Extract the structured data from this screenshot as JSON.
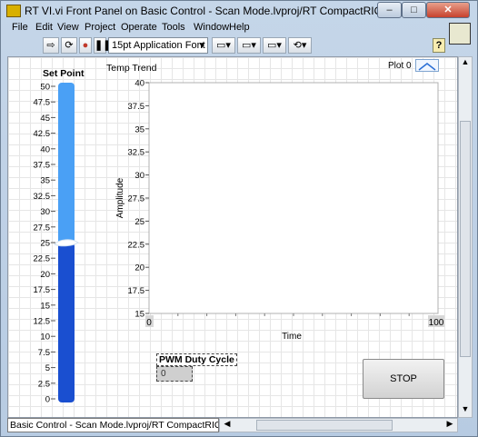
{
  "window": {
    "title": "RT VI.vi Front Panel on Basic Control - Scan Mode.lvproj/RT CompactRIO Target",
    "minimize": "–",
    "maximize": "□",
    "close": "✕"
  },
  "menu": [
    "File",
    "Edit",
    "View",
    "Project",
    "Operate",
    "Tools",
    "Window",
    "Help"
  ],
  "toolbar": {
    "font": "15pt Application Font"
  },
  "set_point": {
    "label": "Set Point",
    "ticks": [
      "50",
      "47.5",
      "45",
      "42.5",
      "40",
      "37.5",
      "35",
      "32.5",
      "30",
      "27.5",
      "25",
      "22.5",
      "20",
      "17.5",
      "15",
      "12.5",
      "10",
      "7.5",
      "5",
      "2.5",
      "0"
    ],
    "value": 25,
    "min": 0,
    "max": 50,
    "upper_color": "#4aa0f5",
    "lower_color": "#1a4fd0"
  },
  "chart": {
    "title": "Temp Trend",
    "legend": "Plot 0",
    "ylabel": "Amplitude",
    "xlabel": "Time",
    "y_ticks": [
      "40",
      "37.5",
      "35",
      "32.5",
      "30",
      "27.5",
      "25",
      "22.5",
      "20",
      "17.5",
      "15"
    ],
    "x_min_label": "0",
    "x_max_label": "100"
  },
  "chart_data": {
    "type": "line",
    "title": "Temp Trend",
    "xlabel": "Time",
    "ylabel": "Amplitude",
    "xlim": [
      0,
      100
    ],
    "ylim": [
      15,
      40
    ],
    "series": [
      {
        "name": "Plot 0",
        "values": []
      }
    ]
  },
  "pwm": {
    "label": "PWM Duty Cycle",
    "value": "0"
  },
  "stop_button": {
    "label": "STOP"
  },
  "status": {
    "text": "Basic Control - Scan Mode.lvproj/RT CompactRIO Target"
  }
}
